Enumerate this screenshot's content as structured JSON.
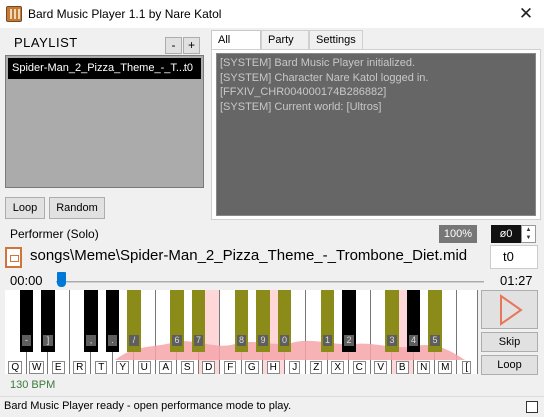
{
  "window": {
    "title": "Bard Music Player 1.1 by Nare Katol",
    "close_symbol": "✕"
  },
  "playlist": {
    "label": "PLAYLIST",
    "remove_label": "-",
    "add_label": "+",
    "items": [
      {
        "name": "Spider-Man_2_Pizza_Theme_-_T...",
        "track": "t0",
        "selected": true
      }
    ],
    "loop_label": "Loop",
    "random_label": "Random"
  },
  "tabs": [
    {
      "label": "All",
      "active": true
    },
    {
      "label": "Party",
      "active": false
    },
    {
      "label": "Settings",
      "active": false
    }
  ],
  "log": {
    "lines": [
      "[SYSTEM] Bard Music Player initialized.",
      "[SYSTEM] Character Nare Katol logged in.",
      "[FFXIV_CHR004000174B286882]",
      "[SYSTEM] Current world: [Ultros]"
    ]
  },
  "performer": {
    "label": "Performer (Solo)",
    "volume": "100%",
    "octave": "ø0",
    "song_path": "songs\\Meme\\Spider-Man_2_Pizza_Theme_-_Trombone_Diet.mid",
    "track": "t0",
    "time_start": "00:00",
    "time_end": "01:27",
    "progress_fraction": 0.01
  },
  "keyboard": {
    "white_keys": [
      {
        "label": "Q",
        "played": false
      },
      {
        "label": "W",
        "played": false
      },
      {
        "label": "E",
        "played": false
      },
      {
        "label": "R",
        "played": false
      },
      {
        "label": "T",
        "played": false
      },
      {
        "label": "Y",
        "played": false
      },
      {
        "label": "U",
        "played": false
      },
      {
        "label": "A",
        "played": false
      },
      {
        "label": "S",
        "played": false
      },
      {
        "label": "D",
        "played": true
      },
      {
        "label": "F",
        "played": false
      },
      {
        "label": "G",
        "played": false
      },
      {
        "label": "H",
        "played": true
      },
      {
        "label": "J",
        "played": false
      },
      {
        "label": "Z",
        "played": false
      },
      {
        "label": "X",
        "played": false
      },
      {
        "label": "C",
        "played": false
      },
      {
        "label": "V",
        "played": false
      },
      {
        "label": "B",
        "played": true
      },
      {
        "label": "N",
        "played": false
      },
      {
        "label": "M",
        "played": false
      },
      {
        "label": "[",
        "played": false
      }
    ],
    "black_keys": [
      {
        "after": 0,
        "label": "-",
        "played": false
      },
      {
        "after": 1,
        "label": "]",
        "played": false
      },
      {
        "after": 3,
        "label": ",",
        "played": false
      },
      {
        "after": 4,
        "label": ".",
        "played": false
      },
      {
        "after": 5,
        "label": "/",
        "played": true
      },
      {
        "after": 7,
        "label": "6",
        "played": true
      },
      {
        "after": 8,
        "label": "7",
        "played": true
      },
      {
        "after": 10,
        "label": "8",
        "played": true
      },
      {
        "after": 11,
        "label": "9",
        "played": true
      },
      {
        "after": 12,
        "label": "0",
        "played": true
      },
      {
        "after": 14,
        "label": "1",
        "played": true
      },
      {
        "after": 15,
        "label": "2",
        "played": false
      },
      {
        "after": 17,
        "label": "3",
        "played": true
      },
      {
        "after": 18,
        "label": "4",
        "played": false
      },
      {
        "after": 19,
        "label": "5",
        "played": true
      }
    ]
  },
  "controls": {
    "skip_label": "Skip",
    "loop_label": "Loop"
  },
  "bpm": "130 BPM",
  "status": {
    "text": "Bard Music Player ready - open performance mode to play."
  },
  "colors": {
    "accent": "#0078d7",
    "play": "#e8765a",
    "played_white": "#ffd7d9",
    "played_black": "#8b8b1a",
    "bpm": "#3c7a3c"
  }
}
